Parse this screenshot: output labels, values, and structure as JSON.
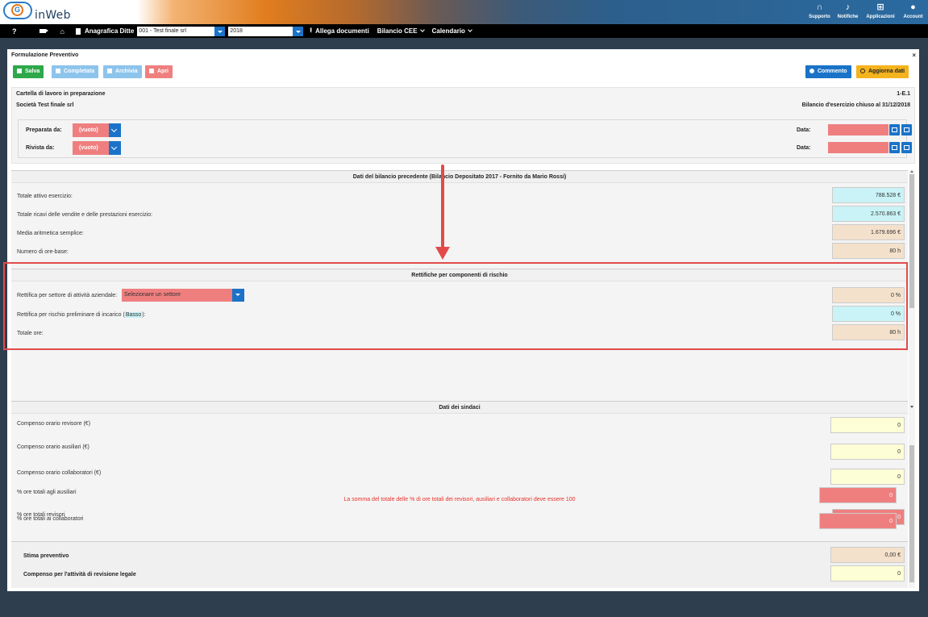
{
  "app": {
    "name": "inWeb"
  },
  "topnav": {
    "supporto": "Supporto",
    "notifiche": "Notifiche",
    "applicazioni": "Applicazioni",
    "account": "Account"
  },
  "menubar": {
    "help": "?",
    "anagrafica_label": "Anagrafica Ditte",
    "company_value": "001 - Test finale srl",
    "year_value": "2018",
    "allega_label": "Allega documenti",
    "bilancio_label": "Bilancio CEE",
    "calendario_label": "Calendario"
  },
  "panel": {
    "title": "Formulazione Preventivo",
    "close": "×",
    "buttons": {
      "salva": "Salva",
      "completata": "Completata",
      "archivia": "Archivia",
      "apri": "Apri",
      "commento": "Commento",
      "aggiorna": "Aggiorna dati"
    }
  },
  "info": {
    "status": "Cartella di lavoro in preparazione",
    "code": "1-E.1",
    "company": "Società Test finale srl",
    "period": "Bilancio d'esercizio chiuso al 31/12/2018",
    "preparata_label": "Preparata da:",
    "rivista_label": "Rivista da:",
    "preparata_value": "(vuoto)",
    "rivista_value": "(vuoto)",
    "data_label": "Data:"
  },
  "bilancio_prec": {
    "header": "Dati del bilancio precedente (Bilancio Depositato 2017 - Fornito da Mario Rossi)",
    "rows": [
      {
        "label": "Totale attivo esercizio:",
        "value": "788.528 €"
      },
      {
        "label": "Totale ricavi delle vendite e delle prestazioni esercizio:",
        "value": "2.570.863 €"
      },
      {
        "label": "Media aritmetica semplice:",
        "value": "1.679.696 €"
      },
      {
        "label": "Numero di ore-base:",
        "value": "80 h"
      }
    ]
  },
  "rettifiche": {
    "header": "Rettifiche per componenti di rischio",
    "settore_label": "Rettifica per settore di attività aziendale:",
    "settore_placeholder": "Selezionare un settore",
    "settore_value": "0 %",
    "rischio_label_prefix": "Rettifica per rischio preliminare di incarico (",
    "rischio_level": "Basso",
    "rischio_label_suffix": "):",
    "rischio_value": "0 %",
    "totale_label": "Totale ore:",
    "totale_value": "80 h"
  },
  "sindaci": {
    "header": "Dati dei sindaci",
    "rows": [
      {
        "label": "Compenso orario revisore (€)",
        "value": "0"
      },
      {
        "label": "Compenso orario ausiliari (€)",
        "value": "0"
      },
      {
        "label": "Compenso orario collaboratori (€)",
        "value": "0"
      }
    ],
    "warning": "La somma del totale delle % di ore totali dei revisori, ausiliari e collaboratori deve essere 100",
    "percent_rows": [
      {
        "label": "% ore totali revisori",
        "value": "0"
      },
      {
        "label": "% ore totali agli ausiliari",
        "value": "0"
      },
      {
        "label": "% ore totali ai collaboratori",
        "value": "0"
      }
    ]
  },
  "stima": {
    "label": "Stima preventivo",
    "value": "0,00 €",
    "compenso_label": "Compenso per l'attività di revisione legale",
    "compenso_value": "0"
  },
  "colors": {
    "primary_blue": "#1a73c8",
    "success_green": "#2ea84a",
    "warning_orange": "#f5b31d",
    "danger_red": "#ef7f7f",
    "annotation_red": "#e24a4a"
  }
}
